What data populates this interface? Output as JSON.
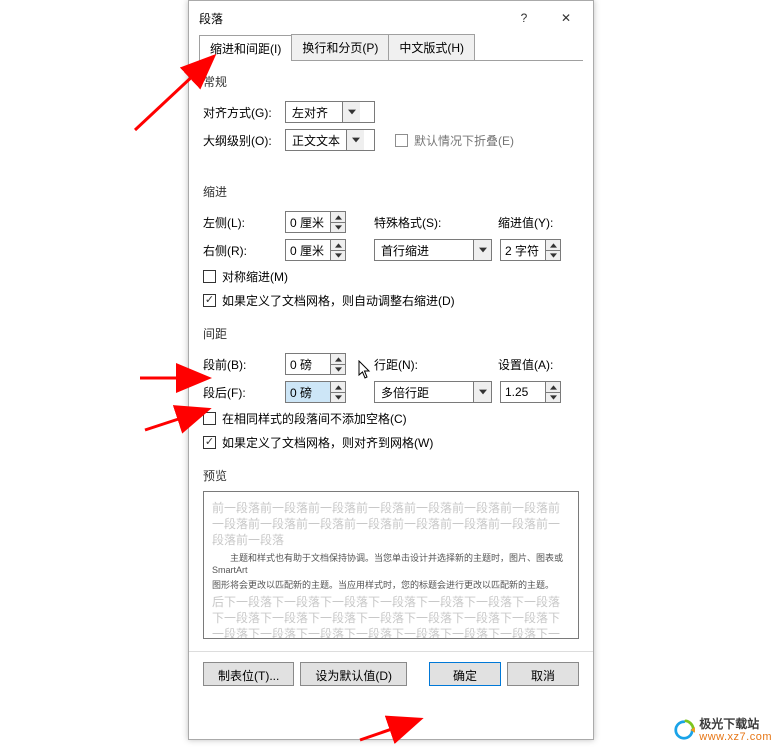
{
  "window": {
    "title": "段落",
    "help": "?",
    "close": "✕"
  },
  "tabs": [
    {
      "label": "缩进和间距(I)"
    },
    {
      "label": "换行和分页(P)"
    },
    {
      "label": "中文版式(H)"
    }
  ],
  "general": {
    "legend": "常规",
    "alignment_label": "对齐方式(G):",
    "alignment_value": "左对齐",
    "outline_label": "大纲级别(O):",
    "outline_value": "正文文本",
    "collapse_label": "默认情况下折叠(E)"
  },
  "indent": {
    "legend": "缩进",
    "left_label": "左侧(L):",
    "left_value": "0 厘米",
    "right_label": "右侧(R):",
    "right_value": "0 厘米",
    "special_label": "特殊格式(S):",
    "special_value": "首行缩进",
    "by_label": "缩进值(Y):",
    "by_value": "2 字符",
    "mirror_label": "对称缩进(M)",
    "autogrid_label": "如果定义了文档网格，则自动调整右缩进(D)"
  },
  "spacing": {
    "legend": "间距",
    "before_label": "段前(B):",
    "before_value": "0 磅",
    "after_label": "段后(F):",
    "after_value": "0 磅",
    "linespacing_label": "行距(N):",
    "linespacing_value": "多倍行距",
    "at_label": "设置值(A):",
    "at_value": "1.25",
    "nospace_label": "在相同样式的段落间不添加空格(C)",
    "snap_label": "如果定义了文档网格，则对齐到网格(W)"
  },
  "preview": {
    "legend": "预览",
    "before_text": "前一段落前一段落前一段落前一段落前一段落前一段落前一段落前一段落前一段落前一段落前一段落前一段落前一段落前一段落前一段落前一段落",
    "mid_text1": "　　主题和样式也有助于文档保持协调。当您单击设计并选择新的主题时，图片、图表或 SmartArt",
    "mid_text2": "图形将会更改以匹配新的主题。当应用样式时，您的标题会进行更改以匹配新的主题。",
    "after_text": "后下一段落下一段落下一段落下一段落下一段落下一段落下一段落下一段落下一段落下一段落下一段落下一段落下一段落下一段落下一段落下一段落下一段落下一段落下一段落下一段落下一段落下一段落下一段落下一段落"
  },
  "footer": {
    "tabs": "制表位(T)...",
    "default": "设为默认值(D)",
    "ok": "确定",
    "cancel": "取消"
  },
  "watermark": {
    "name": "极光下载站",
    "url": "www.xz7.com"
  }
}
